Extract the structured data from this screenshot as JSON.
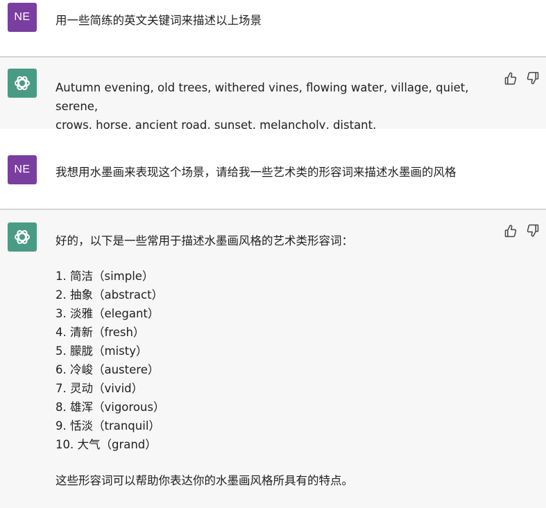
{
  "conversation": [
    {
      "role": "user",
      "avatar_initials": "NE",
      "text": "用一些简练的英文关键词来描述以上场景"
    },
    {
      "role": "assistant",
      "lines": [
        "Autumn evening, old trees, withered vines, flowing water, village, quiet, serene,",
        "crows, horse, ancient road, sunset, melancholy, distant."
      ]
    },
    {
      "role": "user",
      "avatar_initials": "NE",
      "text": "我想用水墨画来表现这个场景，请给我一些艺术类的形容词来描述水墨画的风格"
    },
    {
      "role": "assistant",
      "intro": "好的，以下是一些常用于描述水墨画风格的艺术类形容词：",
      "items": [
        "1. 简洁（simple）",
        "2. 抽象（abstract）",
        "3. 淡雅（elegant）",
        "4. 清新（fresh）",
        "5. 朦胧（misty）",
        "6. 冷峻（austere）",
        "7. 灵动（vivid）",
        "8. 雄浑（vigorous）",
        "9. 恬淡（tranquil）",
        "10. 大气（grand）"
      ],
      "outro": "这些形容词可以帮助你表达你的水墨画风格所具有的特点。"
    }
  ],
  "icons": {
    "assistant_avatar": "openai-logo-icon",
    "like": "thumbs-up-icon",
    "dislike": "thumbs-down-icon"
  },
  "colors": {
    "user_avatar": "#7a3da0",
    "assistant_avatar": "#4a9b83",
    "assistant_bg": "#f7f7f8"
  }
}
